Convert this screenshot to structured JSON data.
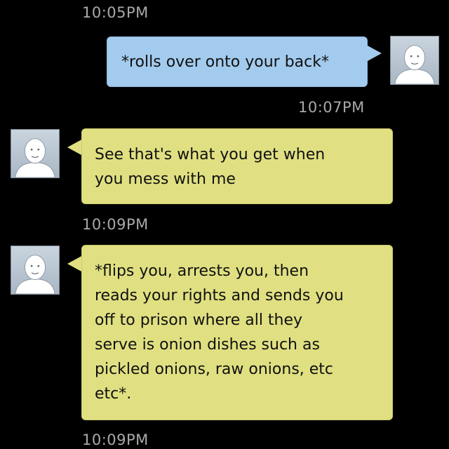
{
  "conversation": {
    "messages": [
      {
        "direction": "outgoing",
        "timestamp": "10:05PM",
        "text": "*rolls over onto your back*",
        "avatar_icon": "default-person-avatar-icon"
      },
      {
        "direction": "incoming",
        "timestamp": "10:07PM",
        "text": "See that's what you get when\nyou mess with me",
        "avatar_icon": "default-person-avatar-icon"
      },
      {
        "direction": "incoming",
        "timestamp": "10:09PM",
        "text": "*flips you, arrests you, then\nreads your rights and sends you\noff to prison where all they\nserve is onion dishes such as\npickled onions, raw onions, etc\netc*.",
        "avatar_icon": "default-person-avatar-icon"
      }
    ],
    "trailing_timestamp": "10:09PM"
  },
  "colors": {
    "background": "#000000",
    "outgoing_bubble": "#a3cbed",
    "incoming_bubble": "#e0e082",
    "timestamp_text": "#a9a9a9"
  }
}
